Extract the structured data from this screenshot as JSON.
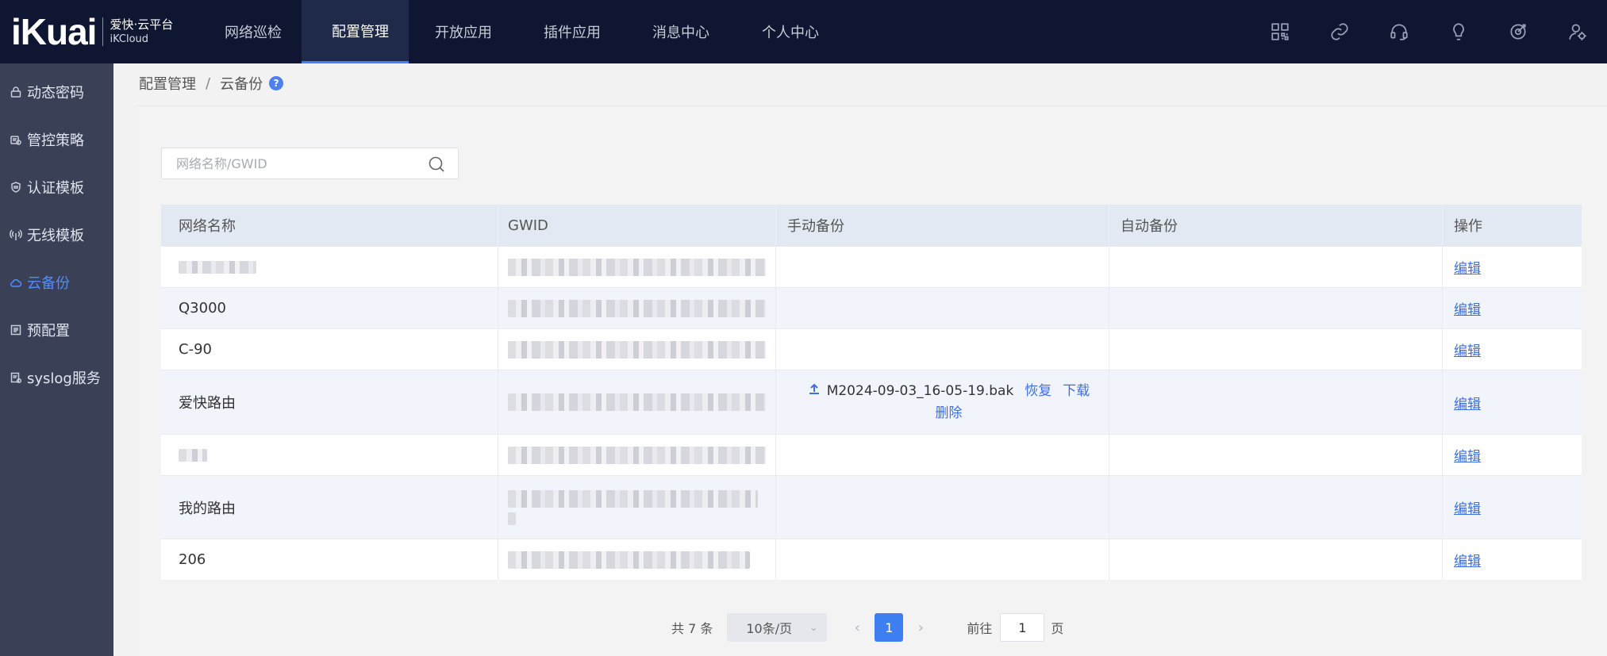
{
  "brand": {
    "mark": "iKuai",
    "line1": "爱快·云平台",
    "line2": "iKCloud"
  },
  "nav": {
    "items": [
      {
        "label": "网络巡检"
      },
      {
        "label": "配置管理",
        "active": true
      },
      {
        "label": "开放应用"
      },
      {
        "label": "插件应用"
      },
      {
        "label": "消息中心"
      },
      {
        "label": "个人中心"
      }
    ],
    "icons": [
      "grid-icon",
      "link-icon",
      "headset-icon",
      "bulb-icon",
      "target-icon",
      "user-settings-icon"
    ]
  },
  "sidebar": {
    "items": [
      {
        "label": "动态密码",
        "icon": "lock-icon"
      },
      {
        "label": "管控策略",
        "icon": "policy-icon"
      },
      {
        "label": "认证模板",
        "icon": "shield-icon"
      },
      {
        "label": "无线模板",
        "icon": "wireless-icon"
      },
      {
        "label": "云备份",
        "icon": "cloud-icon",
        "active": true
      },
      {
        "label": "预配置",
        "icon": "list-icon"
      },
      {
        "label": "syslog服务",
        "icon": "log-icon"
      }
    ]
  },
  "breadcrumb": {
    "parent": "配置管理",
    "separator": "/",
    "current": "云备份",
    "help": "?"
  },
  "search": {
    "placeholder": "网络名称/GWID",
    "value": ""
  },
  "table": {
    "headers": [
      "网络名称",
      "GWID",
      "手动备份",
      "自动备份",
      "操作"
    ],
    "rows": [
      {
        "name": "",
        "edit": "编辑"
      },
      {
        "name": "Q3000",
        "edit": "编辑"
      },
      {
        "name": "C-90",
        "edit": "编辑"
      },
      {
        "name": "爱快路由",
        "edit": "编辑",
        "backup_file": "M2024-09-03_16-05-19.bak",
        "restore": "恢复",
        "download": "下载",
        "delete": "删除"
      },
      {
        "name": "",
        "edit": "编辑"
      },
      {
        "name": "我的路由",
        "edit": "编辑"
      },
      {
        "name": "206",
        "edit": "编辑"
      }
    ]
  },
  "pagination": {
    "total_label": "共 7 条",
    "page_size": "10条/页",
    "current_page": "1",
    "goto_prefix": "前往",
    "goto_value": "1",
    "goto_suffix": "页"
  }
}
